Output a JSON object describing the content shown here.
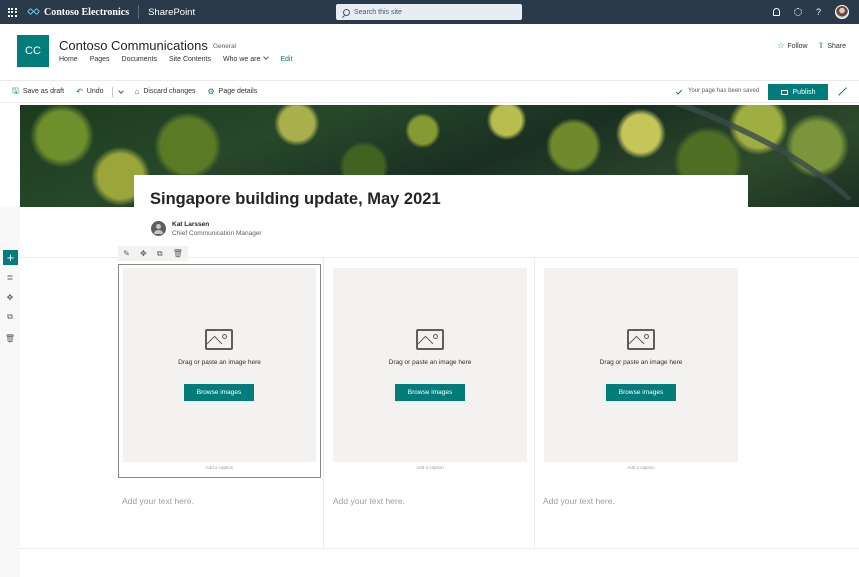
{
  "suite_bar": {
    "org_name": "Contoso Electronics",
    "app_name": "SharePoint",
    "search_placeholder": "Search this site"
  },
  "site": {
    "logo_initials": "CC",
    "title": "Contoso Communications",
    "classification": "General",
    "nav": [
      "Home",
      "Pages",
      "Documents",
      "Site Contents",
      "Who we are"
    ],
    "edit_label": "Edit",
    "follow_label": "Follow",
    "share_label": "Share"
  },
  "command_bar": {
    "save_draft": "Save as draft",
    "undo": "Undo",
    "discard": "Discard changes",
    "page_details": "Page details",
    "saved_status": "Your page has been saved",
    "publish": "Publish"
  },
  "page": {
    "title": "Singapore building update, May 2021",
    "author_name": "Kat Larssen",
    "author_role": "Chief Communication Manager"
  },
  "web_parts": [
    {
      "drag_text": "Drag or paste an image here",
      "browse_label": "Browse images",
      "caption": "Add a caption",
      "text_placeholder": "Add your text here."
    },
    {
      "drag_text": "Drag or paste an image here",
      "browse_label": "Browse images",
      "caption": "Add a caption",
      "text_placeholder": "Add your text here."
    },
    {
      "drag_text": "Drag or paste an image here",
      "browse_label": "Browse images",
      "caption": "Add a caption",
      "text_placeholder": "Add your text here."
    }
  ],
  "colors": {
    "suite_bar": "#2b3a4a",
    "accent": "#037c7c"
  }
}
